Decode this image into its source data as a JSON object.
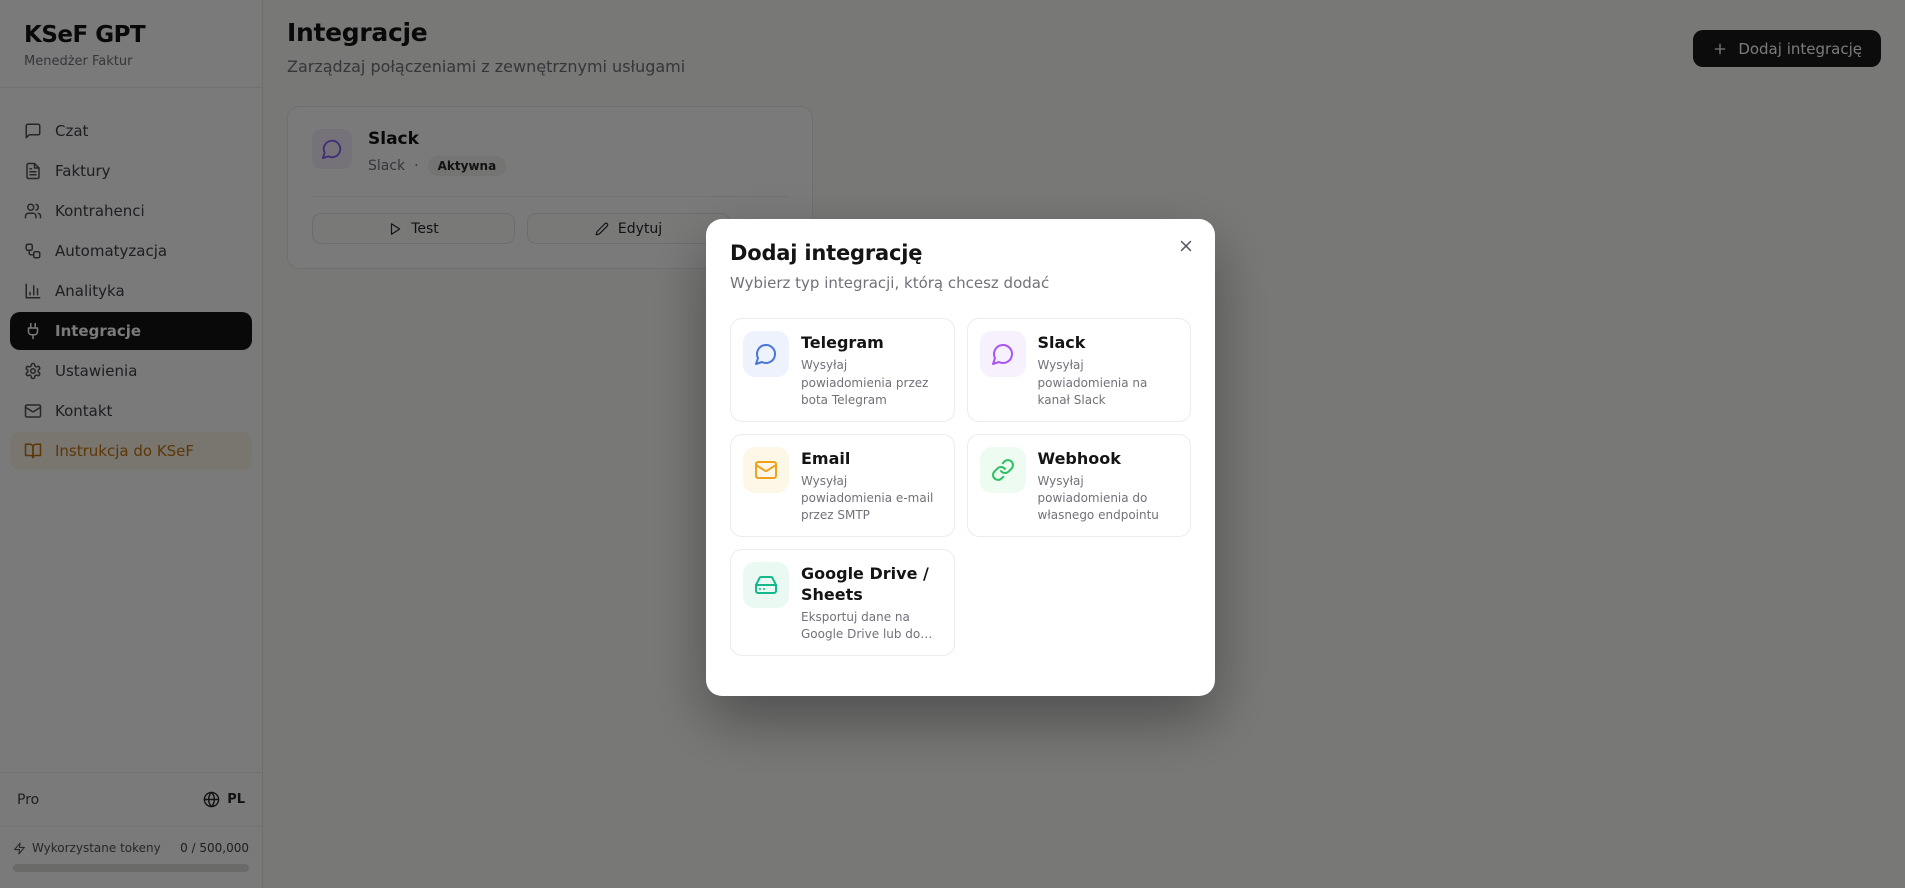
{
  "app": {
    "title": "KSeF GPT",
    "subtitle": "Menedżer Faktur"
  },
  "sidebar": {
    "items": [
      {
        "label": "Czat",
        "icon": "chat-icon"
      },
      {
        "label": "Faktury",
        "icon": "invoice-icon"
      },
      {
        "label": "Kontrahenci",
        "icon": "users-icon"
      },
      {
        "label": "Automatyzacja",
        "icon": "workflow-icon"
      },
      {
        "label": "Analityka",
        "icon": "chart-icon"
      },
      {
        "label": "Integracje",
        "icon": "plug-icon",
        "state": "active"
      },
      {
        "label": "Ustawienia",
        "icon": "gear-icon"
      },
      {
        "label": "Kontakt",
        "icon": "mail-icon"
      },
      {
        "label": "Instrukcja do KSeF",
        "icon": "book-icon",
        "state": "highlight"
      }
    ],
    "footer": {
      "plan": "Pro",
      "language": "PL",
      "tokens_label": "Wykorzystane tokeny",
      "tokens_value": "0 / 500,000",
      "progress_percent": 0
    }
  },
  "header": {
    "title": "Integracje",
    "subtitle": "Zarządzaj połączeniami z zewnętrznymi usługami",
    "add_button": "Dodaj integrację"
  },
  "integration_card": {
    "name": "Slack",
    "type": "Slack",
    "separator": "·",
    "status": "Aktywna",
    "test_button": "Test",
    "edit_button": "Edytuj",
    "icon_color": "#8b5cf6",
    "icon_bg": "#f5effc"
  },
  "modal": {
    "title": "Dodaj integrację",
    "subtitle": "Wybierz typ integracji, którą chcesz dodać",
    "options": [
      {
        "name": "Telegram",
        "description": "Wysyłaj powiadomienia przez bota Telegram",
        "icon": "chat-bubble-icon",
        "color": "#4a76d8",
        "bg": "#eef2fd"
      },
      {
        "name": "Slack",
        "description": "Wysyłaj powiadomienia na kanał Slack",
        "icon": "chat-bubble-icon",
        "color": "#a855f7",
        "bg": "#f7f1fd"
      },
      {
        "name": "Email",
        "description": "Wysyłaj powiadomienia e-mail przez SMTP",
        "icon": "envelope-icon",
        "color": "#efa11d",
        "bg": "#fdf7e8"
      },
      {
        "name": "Webhook",
        "description": "Wysyłaj powiadomienia do własnego endpointu",
        "icon": "link-icon",
        "color": "#2fbf63",
        "bg": "#edfbf1"
      },
      {
        "name": "Google Drive / Sheets",
        "description": "Eksportuj dane na Google Drive lub do…",
        "icon": "hard-drive-icon",
        "color": "#14b88a",
        "bg": "#eafaf2"
      }
    ]
  }
}
